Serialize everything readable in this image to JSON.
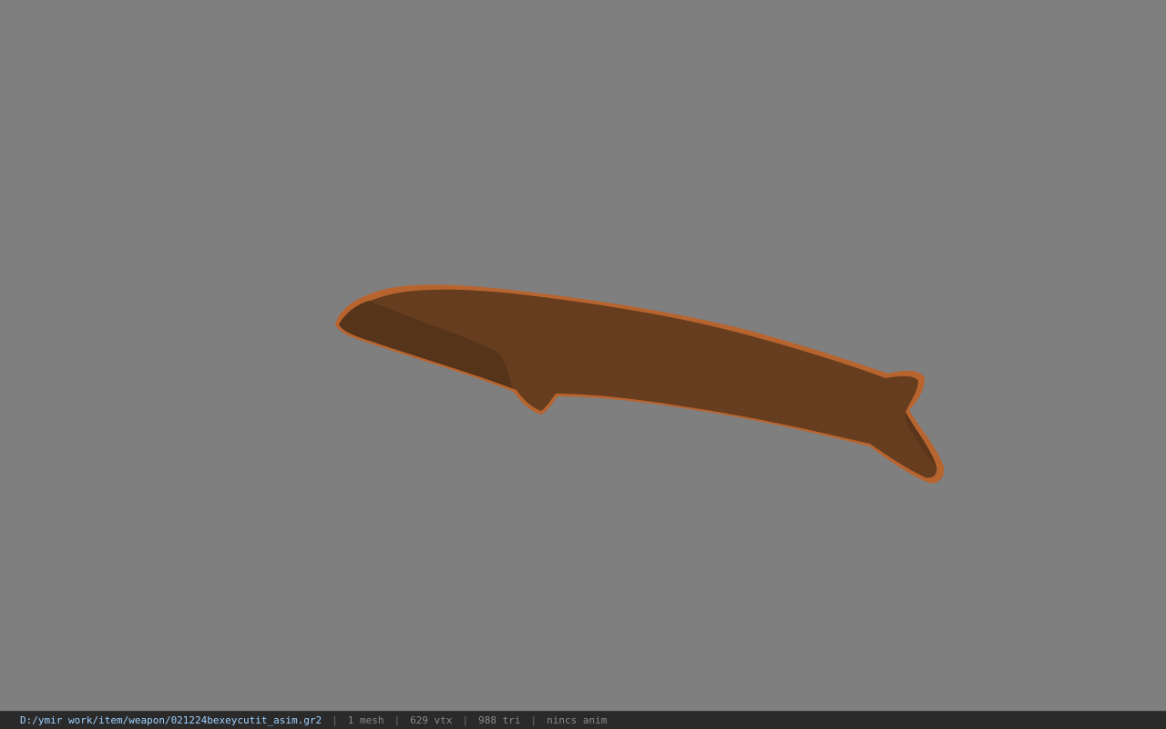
{
  "viewport": {
    "background_color": "#7f7f7f",
    "model": {
      "name": "knife-blade-mesh",
      "face_color": "#663d1f",
      "edge_color": "#b8642f",
      "shade_color": "#56341a"
    }
  },
  "status": {
    "file_path": "D:/ymir work/item/weapon/021224bexeycutit_asim.gr2",
    "separator": "|",
    "mesh_count": "1 mesh",
    "vertex_count": "629 vtx",
    "triangle_count": "988 tri",
    "animation": "nincs anim"
  }
}
